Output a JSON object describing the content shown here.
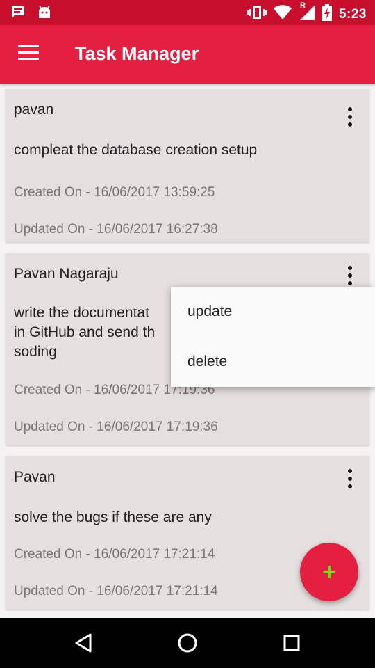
{
  "status_bar": {
    "time": "5:23",
    "icons": [
      "message-icon",
      "android-icon",
      "vibrate-icon",
      "wifi-icon",
      "signal-icon",
      "battery-charging-icon"
    ],
    "roaming_label": "R"
  },
  "app_bar": {
    "title": "Task Manager",
    "menu_icon": "hamburger-menu-icon"
  },
  "tasks": [
    {
      "name": "pavan",
      "description": "compleat the database creation setup",
      "created": "Created On - 16/06/2017 13:59:25",
      "updated": "Updated On - 16/06/2017 16:27:38"
    },
    {
      "name": "Pavan Nagaraju",
      "description_lines": [
        "write the documentat",
        "in GitHub and send th",
        "soding"
      ],
      "created": "Created On - 16/06/2017 17:19:36",
      "updated": "Updated On - 16/06/2017 17:19:36"
    },
    {
      "name": "Pavan",
      "description": "solve the bugs if these are any",
      "created": "Created On - 16/06/2017 17:21:14",
      "updated": "Updated On - 16/06/2017 17:21:14"
    }
  ],
  "popup_menu": {
    "items": [
      "update",
      "delete"
    ]
  },
  "fab": {
    "icon": "plus-icon",
    "label": "+",
    "accent_color": "#7dd321"
  },
  "colors": {
    "primary": "#e51f3f",
    "status_bar": "#c8102e",
    "card": "#e6dfdf"
  }
}
